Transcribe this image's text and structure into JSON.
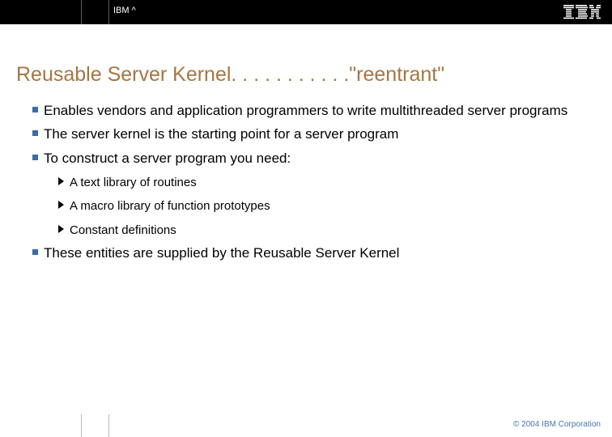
{
  "header": {
    "brand_small": "IBM ^",
    "logo_alt": "IBM"
  },
  "title": "Reusable Server Kernel. . . . . . . . . . .\"reentrant\"",
  "bullets": [
    "Enables vendors and application programmers to write multithreaded server programs",
    "The server kernel is the starting point for a server program",
    "To construct a server program you need:"
  ],
  "subbullets": [
    "A text library of routines",
    "A macro library of function prototypes",
    "Constant definitions"
  ],
  "bullets_after": [
    "These entities are supplied by the Reusable Server Kernel"
  ],
  "footer": {
    "copyright": "© 2004 IBM Corporation"
  }
}
